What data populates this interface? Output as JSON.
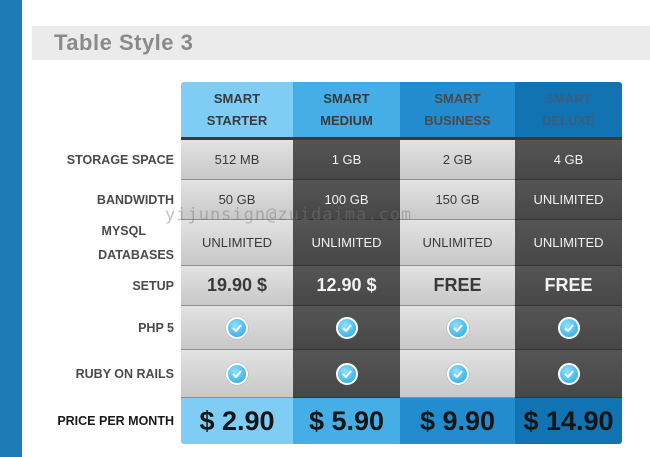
{
  "title": "Table Style 3",
  "plans": [
    {
      "line1": "SMART",
      "line2": "STARTER",
      "price": "$ 2.90"
    },
    {
      "line1": "SMART",
      "line2": "MEDIUM",
      "price": "$ 5.90"
    },
    {
      "line1": "SMART",
      "line2": "BUSINESS",
      "price": "$ 9.90"
    },
    {
      "line1": "SMART",
      "line2": "DELUXE",
      "price": "$ 14.90"
    }
  ],
  "rows": {
    "storage": {
      "label": "STORAGE SPACE",
      "values": [
        "512 MB",
        "1 GB",
        "2 GB",
        "4 GB"
      ]
    },
    "bandwidth": {
      "label": "BANDWIDTH",
      "values": [
        "50 GB",
        "100 GB",
        "150 GB",
        "UNLIMITED"
      ]
    },
    "mysql": {
      "label1": "MYSQL",
      "label2": "DATABASES",
      "values": [
        "UNLIMITED",
        "UNLIMITED",
        "UNLIMITED",
        "UNLIMITED"
      ]
    },
    "setup": {
      "label": "SETUP",
      "values": [
        "19.90 $",
        "12.90 $",
        "FREE",
        "FREE"
      ]
    },
    "php": {
      "label": "PHP 5",
      "icon": "check-circle-icon"
    },
    "ruby": {
      "label": "RUBY ON RAILS",
      "icon": "check-circle-icon"
    }
  },
  "price_label": "PRICE PER MONTH",
  "watermark": "yijunsign@zuidaima.com",
  "colors": {
    "starter": "#7fcdf5",
    "medium": "#45aee6",
    "business": "#238ccf",
    "deluxe": "#1273b2",
    "accent_bar": "#1f7ab8"
  }
}
